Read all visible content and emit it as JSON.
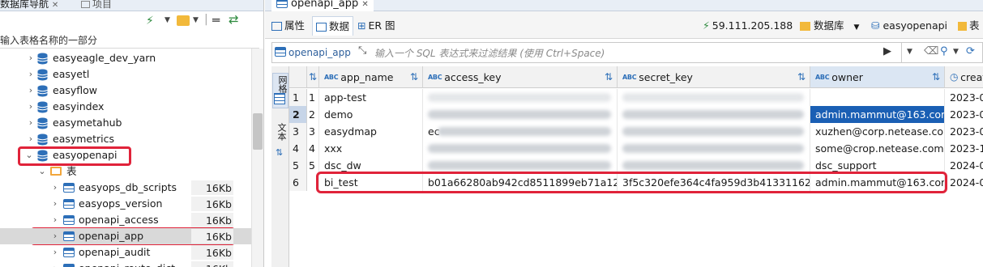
{
  "left_panel": {
    "tab_db_nav": "数据库导航",
    "tab_project": "项目",
    "filter_placeholder": "输入表格名称的一部分",
    "databases": [
      "easyeagle_dev_yarn",
      "easyetl",
      "easyflow",
      "easyindex",
      "easymetahub",
      "easymetrics",
      "easyopenapi"
    ],
    "tables_folder": "表",
    "tables": [
      {
        "name": "easyops_db_scripts",
        "size": "16Kb"
      },
      {
        "name": "easyops_version",
        "size": "16Kb"
      },
      {
        "name": "openapi_access",
        "size": "16Kb"
      },
      {
        "name": "openapi_app",
        "size": "16Kb"
      },
      {
        "name": "openapi_audit",
        "size": "16Kb"
      },
      {
        "name": "openapi_route_dict",
        "size": "16Kb"
      }
    ]
  },
  "editor": {
    "tab_title": "openapi_app",
    "sub_tabs": {
      "properties": "属性",
      "data": "数据",
      "er": "ER 图"
    },
    "server": "59.111.205.188",
    "database_label": "数据库",
    "schema": "easyopenapi",
    "table_label": "表",
    "filter_table": "openapi_app",
    "filter_placeholder": "输入一个 SQL 表达式来过滤结果 (使用 Ctrl+Space)",
    "side_tabs": {
      "grid": "网格",
      "text": "文本"
    },
    "columns": [
      "app_name",
      "access_key",
      "secret_key",
      "owner",
      "create"
    ],
    "rows": [
      {
        "num": "1",
        "id": "1",
        "app_name": "app-test",
        "access_key": "",
        "secret_key": "",
        "owner": "",
        "created": "2023-0"
      },
      {
        "num": "2",
        "id": "2",
        "app_name": "demo",
        "access_key": "",
        "secret_key": "",
        "owner": "admin.mammut@163.com",
        "created": "2023-0"
      },
      {
        "num": "3",
        "id": "3",
        "app_name": "easydmap",
        "access_key": "ec",
        "secret_key": "",
        "owner": "xuzhen@corp.netease.com",
        "created": "2023-0"
      },
      {
        "num": "4",
        "id": "4",
        "app_name": "xxx",
        "access_key": "",
        "secret_key": "",
        "owner": "some@crop.netease.com",
        "created": "2023-1"
      },
      {
        "num": "5",
        "id": "5",
        "app_name": "dsc_dw",
        "access_key": "",
        "secret_key": "",
        "owner": "dsc_support",
        "created": "2024-0"
      },
      {
        "num": "6",
        "id": "",
        "app_name": "bi_test",
        "access_key": "b01a66280ab942cd8511899eb71a124e",
        "secret_key": "3f5c320efe364c4fa959d3b413311621",
        "owner": "admin.mammut@163.com",
        "created": "2024-0"
      }
    ]
  },
  "colors": {
    "highlight_red": "#e0233a",
    "accent_blue": "#2d6fb8",
    "selected_cell": "#1a5fb4"
  }
}
